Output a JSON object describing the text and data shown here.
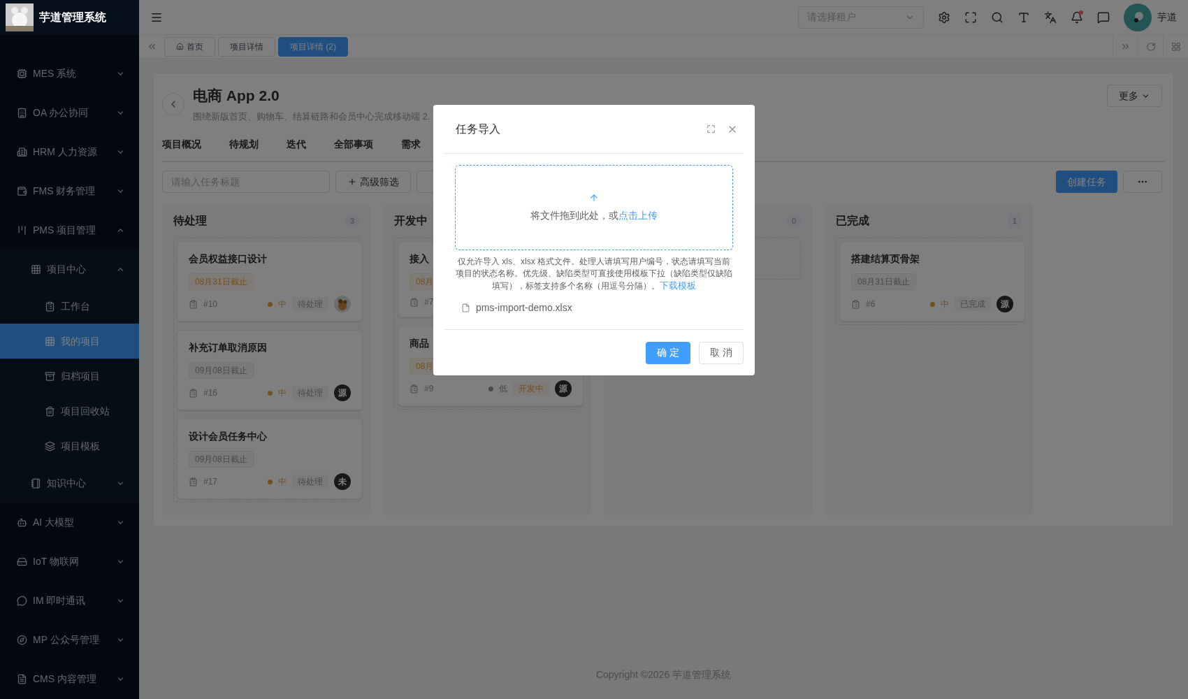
{
  "app": {
    "title": "芋道管理系统"
  },
  "sidebar": {
    "items": [
      {
        "label": "MES 系统",
        "expanded": false,
        "selected": false
      },
      {
        "label": "OA 办公协同",
        "expanded": false,
        "selected": false
      },
      {
        "label": "HRM 人力资源",
        "expanded": false,
        "selected": false
      },
      {
        "label": "FMS 财务管理",
        "expanded": false,
        "selected": false
      },
      {
        "label": "PMS 项目管理",
        "expanded": true,
        "selected": false,
        "children": [
          {
            "label": "项目中心",
            "expanded": true,
            "selected": false,
            "children": [
              {
                "label": "工作台",
                "selected": false
              },
              {
                "label": "我的项目",
                "selected": true
              },
              {
                "label": "归档项目",
                "selected": false
              },
              {
                "label": "项目回收站",
                "selected": false
              },
              {
                "label": "项目模板",
                "selected": false
              }
            ]
          },
          {
            "label": "知识中心",
            "expanded": false,
            "selected": false
          }
        ]
      },
      {
        "label": "AI 大模型",
        "expanded": false,
        "selected": false
      },
      {
        "label": "IoT 物联网",
        "expanded": false,
        "selected": false
      },
      {
        "label": "IM 即时通讯",
        "expanded": false,
        "selected": false
      },
      {
        "label": "MP 公众号管理",
        "expanded": false,
        "selected": false
      },
      {
        "label": "CMS 内容管理",
        "expanded": false,
        "selected": false
      }
    ]
  },
  "header": {
    "tenant_select": {
      "placeholder": "请选择租户"
    },
    "user": {
      "name": "芋道"
    },
    "notification_dot": true
  },
  "tabs": [
    {
      "label": "首页",
      "selected": false,
      "kind": "home"
    },
    {
      "label": "项目详情",
      "selected": false,
      "kind": "plain"
    },
    {
      "label": "项目详情 (2)",
      "selected": true,
      "kind": "plain"
    }
  ],
  "project": {
    "title": "电商 App 2.0",
    "description": "围绕新版首页、购物车、结算链路和会员中心完成移动端 2.",
    "more_button": "更多",
    "tabs": [
      {
        "label": "项目概况"
      },
      {
        "label": "待规划"
      },
      {
        "label": "迭代"
      },
      {
        "label": "全部事项"
      },
      {
        "label": "需求"
      }
    ],
    "search": {
      "placeholder": "请输入任务标题"
    },
    "filter_button": "高级筛选",
    "create_button": "创建任务"
  },
  "columns": [
    {
      "title": "待处理",
      "count": "3",
      "cards": [
        {
          "title": "会员权益接口设计",
          "deadline": "08月31日截止",
          "overdue": true,
          "id": "#10",
          "priority": {
            "label": "中",
            "color": "#73511e"
          },
          "status": {
            "label": "待处理",
            "kind": "info"
          }
        },
        {
          "title": "补充订单取消原因",
          "deadline": "09月08日截止",
          "overdue": false,
          "id": "#16",
          "priority": {
            "label": "中",
            "color": "#73511e"
          },
          "status": {
            "label": "待处理",
            "kind": "info"
          },
          "avatar": {
            "kind": "letter",
            "text": "源"
          }
        },
        {
          "title": "设计会员任务中心",
          "deadline": "09月08日截止",
          "overdue": false,
          "id": "#17",
          "priority": {
            "label": "中",
            "color": "#73511e"
          },
          "status": {
            "label": "待处理",
            "kind": "info"
          },
          "avatar": {
            "kind": "letter",
            "text": "未"
          }
        }
      ]
    },
    {
      "title": "开发中",
      "cards": [
        {
          "title": "接入",
          "deadline": "08月",
          "overdue": true,
          "id": "#7"
        },
        {
          "title": "商品",
          "deadline": "08月",
          "overdue": true,
          "id": "#9",
          "priority": {
            "label": "低",
            "color": "#484a4c"
          },
          "status": {
            "label": "开发中",
            "kind": "warning"
          },
          "avatar": {
            "kind": "letter",
            "text": "源"
          }
        }
      ]
    },
    {
      "count": "0"
    },
    {
      "title": "已完成",
      "count": "1",
      "cards": [
        {
          "title": "搭建结算页骨架",
          "deadline": "08月31日截止",
          "overdue": false,
          "id": "#6",
          "priority": {
            "label": "中",
            "color": "#73511e"
          },
          "status": {
            "label": "已完成",
            "kind": "info"
          },
          "avatar": {
            "kind": "letter",
            "text": "源"
          }
        }
      ]
    }
  ],
  "dialog": {
    "title": "任务导入",
    "drop_text": "将文件拖到此处，或",
    "upload_link": "点击上传",
    "hint": "仅允许导入 xls、xlsx 格式文件。处理人请填写用户编号，状态请填写当前项目的状态名称。优先级、缺陷类型可直接使用模板下拉（缺陷类型仅缺陷填写），标签支持多个名称（用逗号分隔）。",
    "template_link": "下载模板",
    "file": "pms-import-demo.xlsx",
    "confirm": "确 定",
    "cancel": "取 消"
  },
  "footer": "Copyright ©2026 芋道管理系统"
}
